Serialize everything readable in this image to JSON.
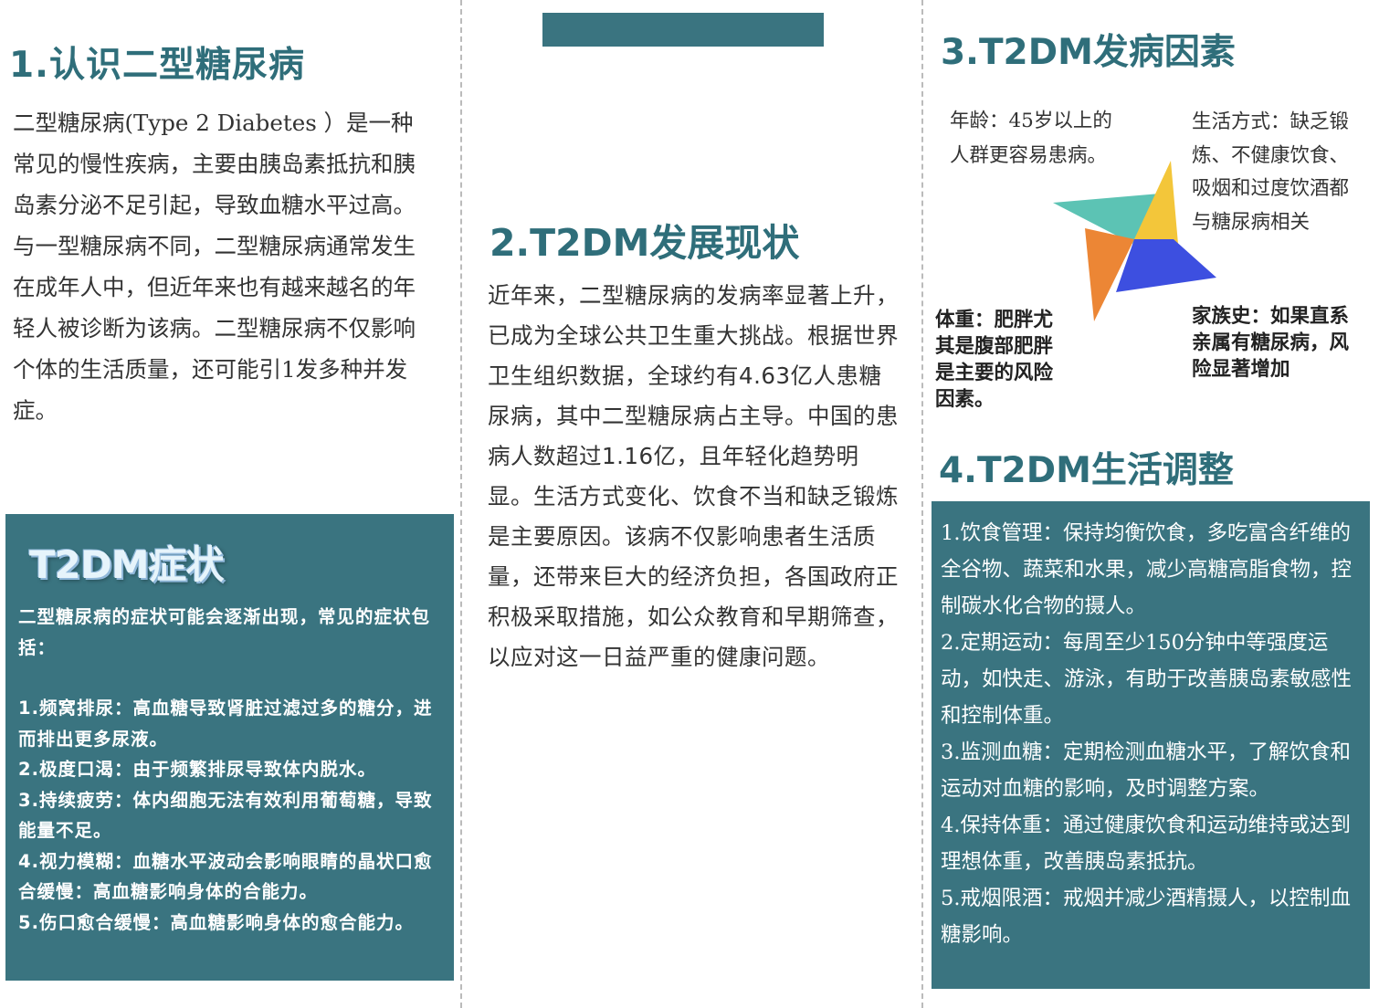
{
  "section1": {
    "title": "1.认识二型糖尿病",
    "body": "二型糖尿病(Type 2 Diabetes ）是一种常见的慢性疾病，主要由胰岛素抵抗和胰岛素分泌不足引起，导致血糖水平过高。与一型糖尿病不同，二型糖尿病通常发生在成年人中，但近年来也有越来越名的年轻人被诊断为该病。二型糖尿病不仅影响个体的生活质量，还可能引1发多种并发症。"
  },
  "symptoms": {
    "title": "T2DM症状",
    "intro": "二型糖尿病的症状可能会逐渐出现，常见的症状包括：",
    "items": [
      "1.频窝排尿：高血糖导致肾脏过滤过多的糖分，进而排出更多尿液。",
      "2.极度口渴：由于频繁排尿导致体内脱水。",
      "3.持续疲劳：体内细胞无法有效利用葡萄糖，导致能量不足。",
      "4.视力模糊：血糖水平波动会影响眼睛的晶状口愈合缓慢：高血糖影响身体的合能力。",
      "5.伤口愈合缓慢：高血糖影响身体的愈合能力。"
    ]
  },
  "section2": {
    "title": "2.T2DM发展现状",
    "body": "近年来，二型糖尿病的发病率显著上升，已成为全球公共卫生重大挑战。根据世界卫生组织数据，全球约有4.63亿人患糖尿病，其中二型糖尿病占主导。中国的患病人数超过1.16亿，且年轻化趋势明显。生活方式变化、饮食不当和缺乏锻炼是主要原因。该病不仅影响患者生活质量，还带来巨大的经济负担，各国政府正积极采取措施，如公众教育和早期筛查，以应对这一日益严重的健康问题。"
  },
  "section3": {
    "title": "3.T2DM发病因素",
    "factors": {
      "age": "年龄：45岁以上的人群更容易患病。",
      "lifestyle": "生活方式：缺乏锻炼、不健康饮食、吸烟和过度饮酒都与糖尿病相关",
      "weight": "体重：肥胖尤其是腹部肥胖是主要的风险因素。",
      "family": "家族史：如果直系亲属有糖尿病，风险显著增加"
    },
    "colors": {
      "teal": "#5cc3b4",
      "yellow": "#f3c63a",
      "orange": "#ec8635",
      "blue": "#3d4fe0"
    }
  },
  "section4": {
    "title": "4.T2DM生活调整",
    "items": [
      "1.饮食管理：保持均衡饮食，多吃富含纤维的全谷物、蔬菜和水果，减少高糖高脂食物，控制碳水化合物的摄人。",
      "2.定期运动：每周至少150分钟中等强度运动，如快走、游泳，有助于改善胰岛素敏感性和控制体重。",
      "3.监测血糖：定期检测血糖水平，了解饮食和运动对血糖的影响，及时调整方案。",
      "4.保持体重：通过健康饮食和运动维持或达到理想体重，改善胰岛素抵抗。",
      "5.戒烟限酒：戒烟并减少酒精摄人，以控制血糖影响。"
    ]
  },
  "colors": {
    "primary": "#3a7480",
    "heading": "#2f6e7a"
  }
}
